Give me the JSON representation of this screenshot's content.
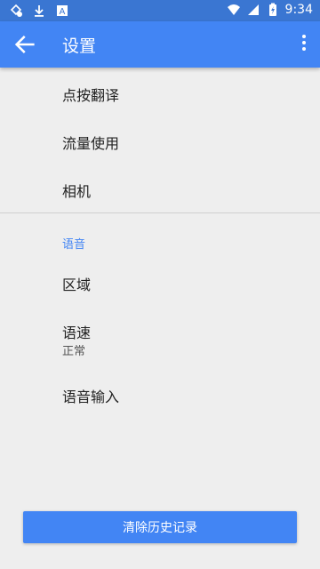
{
  "status_bar": {
    "time": "9:34",
    "battery_level": "⚡",
    "icons": [
      "notification-icon",
      "download-icon",
      "app-a-icon",
      "wifi-icon",
      "signal-icon",
      "battery-icon"
    ]
  },
  "app_bar": {
    "title": "设置",
    "back_icon": "arrow-left-icon",
    "menu_icon": "more-vert-icon"
  },
  "settings": {
    "items_top": [
      {
        "label": "点按翻译"
      },
      {
        "label": "流量使用"
      },
      {
        "label": "相机"
      }
    ],
    "section_voice": {
      "header": "语音",
      "items": [
        {
          "label": "区域"
        },
        {
          "label": "语速",
          "value": "正常"
        },
        {
          "label": "语音输入"
        }
      ]
    }
  },
  "actions": {
    "clear_history": "清除历史记录"
  },
  "colors": {
    "accent": "#4285f4",
    "status_bar": "#3a76d2",
    "background": "#eeeeee"
  }
}
